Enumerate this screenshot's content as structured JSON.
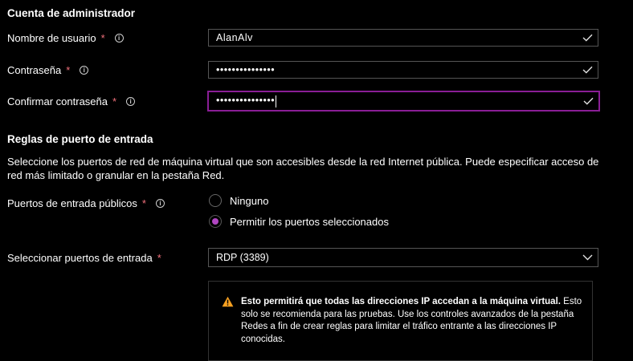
{
  "admin": {
    "title": "Cuenta de administrador",
    "username_label": "Nombre de usuario",
    "username_value": "AlanAlv",
    "password_label": "Contraseña",
    "password_value": "•••••••••••••••",
    "confirm_label": "Confirmar contraseña",
    "confirm_value": "•••••••••••••••",
    "required_mark": "*",
    "info_glyph": "i"
  },
  "ports": {
    "title": "Reglas de puerto de entrada",
    "description": "Seleccione los puertos de red de máquina virtual que son accesibles desde la red Internet pública. Puede especificar acceso de red más limitado o granular en la pestaña Red.",
    "public_ports_label": "Puertos de entrada públicos",
    "option_none": "Ninguno",
    "option_selected": "Permitir los puertos seleccionados",
    "select_label": "Seleccionar puertos de entrada",
    "select_value": "RDP (3389)"
  },
  "warning": {
    "bold": "Esto permitirá que todas las direcciones IP accedan a la máquina virtual.",
    "body": " Esto solo se recomienda para las pruebas.  Use los controles avanzados de la pestaña Redes a fin de crear reglas para limitar el tráfico entrante a las direcciones IP conocidas."
  },
  "colors": {
    "accent": "#8a1e96",
    "required": "#f1707b",
    "warning_icon": "#f7a021"
  }
}
